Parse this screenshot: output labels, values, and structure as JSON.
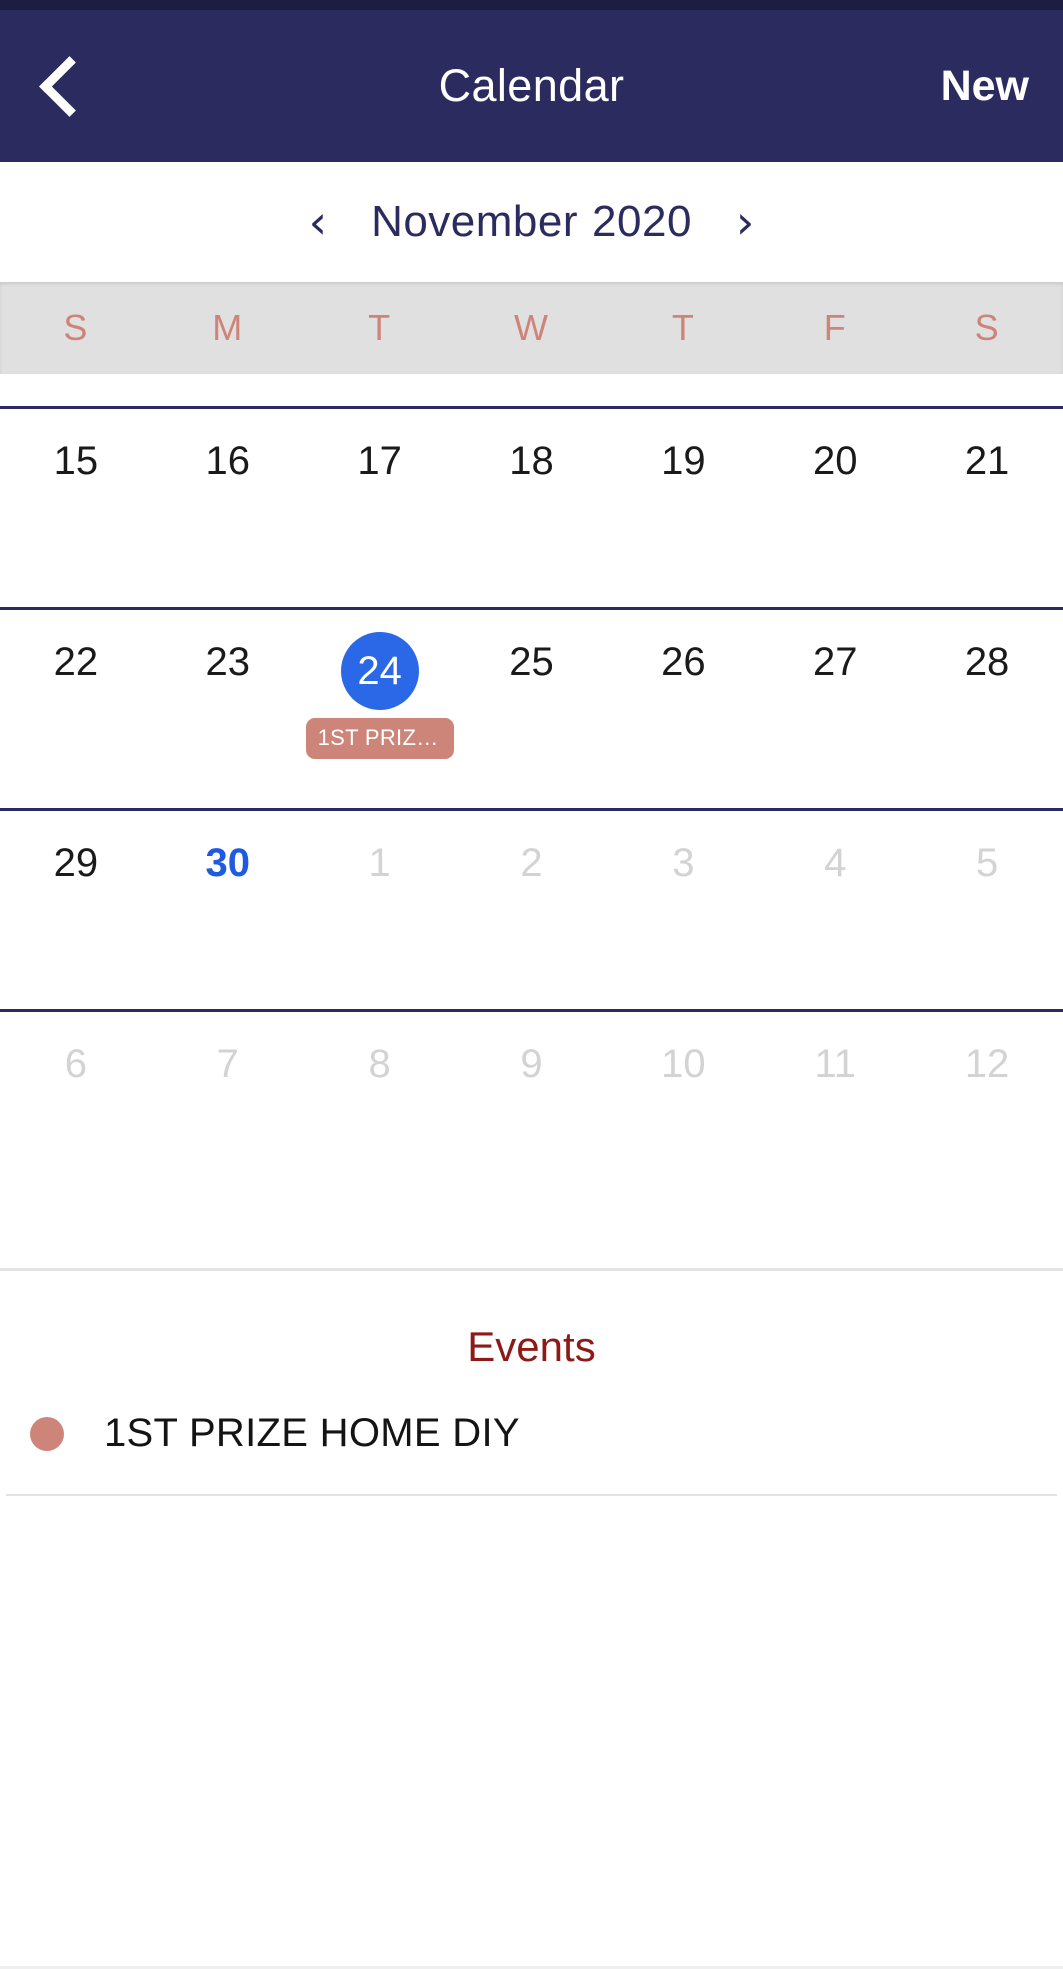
{
  "appbar": {
    "back_icon": "chevron-left-icon",
    "title": "Calendar",
    "new_label": "New"
  },
  "month_nav": {
    "prev_icon": "‹",
    "next_icon": "›",
    "month": "November",
    "year": "2020"
  },
  "weekdays": [
    "S",
    "M",
    "T",
    "W",
    "T",
    "F",
    "S"
  ],
  "weeks": [
    [
      {
        "day": "15",
        "state": "normal"
      },
      {
        "day": "16",
        "state": "normal"
      },
      {
        "day": "17",
        "state": "normal"
      },
      {
        "day": "18",
        "state": "normal"
      },
      {
        "day": "19",
        "state": "normal"
      },
      {
        "day": "20",
        "state": "normal"
      },
      {
        "day": "21",
        "state": "normal"
      }
    ],
    [
      {
        "day": "22",
        "state": "normal"
      },
      {
        "day": "23",
        "state": "normal"
      },
      {
        "day": "24",
        "state": "selected",
        "chip": "1ST PRIZE..."
      },
      {
        "day": "25",
        "state": "normal"
      },
      {
        "day": "26",
        "state": "normal"
      },
      {
        "day": "27",
        "state": "normal"
      },
      {
        "day": "28",
        "state": "normal"
      }
    ],
    [
      {
        "day": "29",
        "state": "normal"
      },
      {
        "day": "30",
        "state": "today"
      },
      {
        "day": "1",
        "state": "muted"
      },
      {
        "day": "2",
        "state": "muted"
      },
      {
        "day": "3",
        "state": "muted"
      },
      {
        "day": "4",
        "state": "muted"
      },
      {
        "day": "5",
        "state": "muted"
      }
    ],
    [
      {
        "day": "6",
        "state": "muted"
      },
      {
        "day": "7",
        "state": "muted"
      },
      {
        "day": "8",
        "state": "muted"
      },
      {
        "day": "9",
        "state": "muted"
      },
      {
        "day": "10",
        "state": "muted"
      },
      {
        "day": "11",
        "state": "muted"
      },
      {
        "day": "12",
        "state": "muted"
      }
    ]
  ],
  "events": {
    "title": "Events",
    "items": [
      {
        "name": "1ST PRIZE HOME DIY",
        "dot_color": "#cd8579"
      }
    ]
  },
  "colors": {
    "appbar_bg": "#2b2b60",
    "status_strip": "#1d1d42",
    "weekday_text": "#cd8579",
    "weekday_bg": "#e0e0e0",
    "selected_day_bg": "#2a68e8",
    "today_text": "#1f5ae0",
    "muted_day_text": "#d3d3d3",
    "event_chip_bg": "#cd8579",
    "events_title": "#8e1a18",
    "week_separator": "#2b2b60"
  }
}
